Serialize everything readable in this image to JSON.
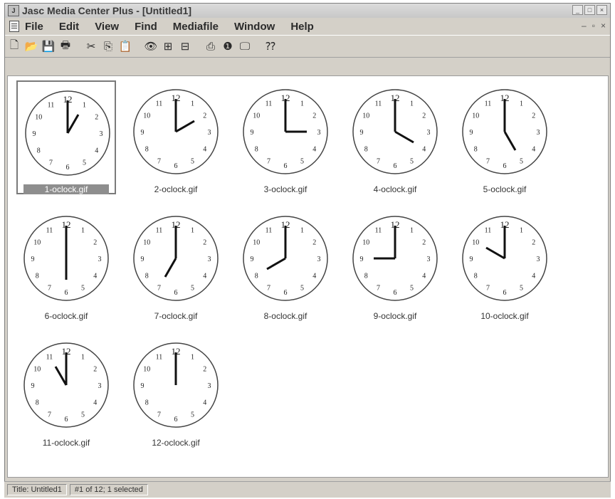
{
  "window": {
    "title": "Jasc Media Center Plus - [Untitled1]"
  },
  "menu": [
    "File",
    "Edit",
    "View",
    "Find",
    "Mediafile",
    "Window",
    "Help"
  ],
  "toolbar": {
    "icons": [
      "new-icon",
      "open-icon",
      "save-icon",
      "print-icon",
      "cut-icon",
      "copy-icon",
      "paste-icon",
      "view-icon",
      "add-file-icon",
      "import-icon",
      "edit-icon",
      "info-icon",
      "slideshow-icon",
      "help-context-icon"
    ],
    "glyphs": [
      "🗋",
      "📂",
      "💾",
      "🖶",
      "✂",
      "⎘",
      "📋",
      "👁",
      "⊞",
      "⊟",
      "⎙",
      "❶",
      "🖵",
      "⁇"
    ]
  },
  "thumbnails": [
    {
      "label": "1-oclock.gif",
      "hour": 1,
      "selected": true
    },
    {
      "label": "2-oclock.gif",
      "hour": 2,
      "selected": false
    },
    {
      "label": "3-oclock.gif",
      "hour": 3,
      "selected": false
    },
    {
      "label": "4-oclock.gif",
      "hour": 4,
      "selected": false
    },
    {
      "label": "5-oclock.gif",
      "hour": 5,
      "selected": false
    },
    {
      "label": "6-oclock.gif",
      "hour": 6,
      "selected": false
    },
    {
      "label": "7-oclock.gif",
      "hour": 7,
      "selected": false
    },
    {
      "label": "8-oclock.gif",
      "hour": 8,
      "selected": false
    },
    {
      "label": "9-oclock.gif",
      "hour": 9,
      "selected": false
    },
    {
      "label": "10-oclock.gif",
      "hour": 10,
      "selected": false
    },
    {
      "label": "11-oclock.gif",
      "hour": 11,
      "selected": false
    },
    {
      "label": "12-oclock.gif",
      "hour": 12,
      "selected": false
    }
  ],
  "clock_numbers": [
    "12",
    "1",
    "2",
    "3",
    "4",
    "5",
    "6",
    "7",
    "8",
    "9",
    "10",
    "11"
  ],
  "status": {
    "title": "Title: Untitled1",
    "selection": "#1 of 12; 1 selected"
  }
}
